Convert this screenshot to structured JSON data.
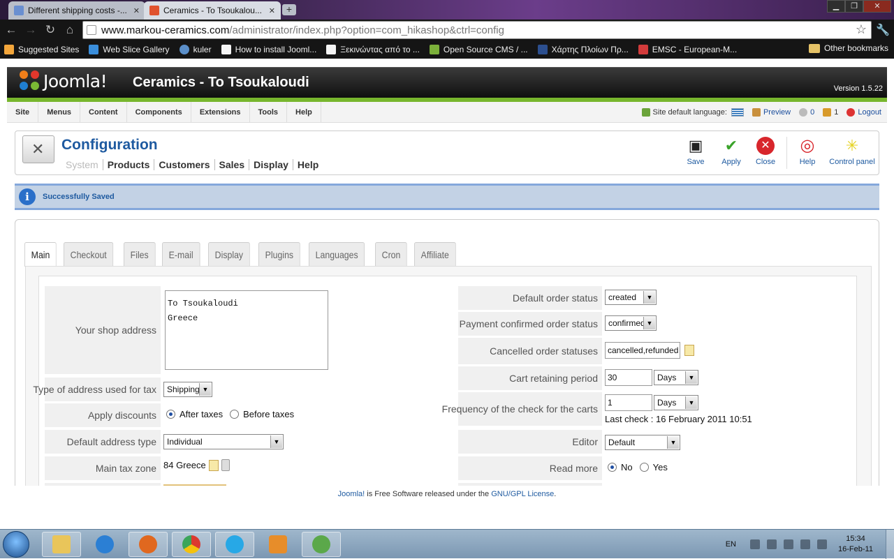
{
  "browser": {
    "tabs": [
      {
        "title": "Different shipping costs -...",
        "active": false
      },
      {
        "title": "Ceramics - To Tsoukalou...",
        "active": true
      }
    ],
    "url_domain": "www.markou-ceramics.com",
    "url_path": "/administrator/index.php?option=com_hikashop&ctrl=config",
    "bookmarks": [
      {
        "label": "Suggested Sites",
        "icon": "suggested-sites-icon"
      },
      {
        "label": "Web Slice Gallery",
        "icon": "web-slice-icon"
      },
      {
        "label": "kuler",
        "icon": "kuler-icon"
      },
      {
        "label": "How to install Jooml...",
        "icon": "page-icon"
      },
      {
        "label": "Ξεκινώντας από το ...",
        "icon": "page-icon"
      },
      {
        "label": "Open Source CMS / ...",
        "icon": "cube-icon"
      },
      {
        "label": "Χάρτης Πλοίων Πρ...",
        "icon": "ship-icon"
      },
      {
        "label": "EMSC - European-M...",
        "icon": "emsc-icon"
      }
    ],
    "other_bookmarks": "Other bookmarks"
  },
  "joomla": {
    "logo_text": "Joomla!",
    "site_title": "Ceramics - To Tsoukaloudi",
    "version": "Version 1.5.22",
    "menu": [
      "Site",
      "Menus",
      "Content",
      "Components",
      "Extensions",
      "Tools",
      "Help"
    ],
    "status": {
      "language_label": "Site default language:",
      "preview": "Preview",
      "messages_count": "0",
      "users_count": "1",
      "logout": "Logout"
    }
  },
  "config": {
    "title": "Configuration",
    "submenu": [
      "System",
      "Products",
      "Customers",
      "Sales",
      "Display",
      "Help"
    ],
    "toolbar": [
      "Save",
      "Apply",
      "Close",
      "Help",
      "Control panel"
    ],
    "message": "Successfully Saved",
    "tabs": [
      "Main",
      "Checkout",
      "Files",
      "E-mail",
      "Display",
      "Plugins",
      "Languages",
      "Cron",
      "Affiliate"
    ]
  },
  "form_left": {
    "shop_address_label": "Your shop address",
    "shop_address_line1": "To Tsoukaloudi",
    "shop_address_line2": "Greece",
    "tax_address_label": "Type of address used for tax",
    "tax_address_value": "Shipping",
    "apply_discounts_label": "Apply discounts",
    "apply_discounts_opt1": "After taxes",
    "apply_discounts_opt2": "Before taxes",
    "default_address_type_label": "Default address type",
    "default_address_type_value": "Individual",
    "main_tax_zone_label": "Main tax zone",
    "main_tax_zone_value": "84 Greece"
  },
  "form_right": {
    "default_order_status_label": "Default order status",
    "default_order_status_value": "created",
    "payment_confirmed_label": "Payment confirmed order status",
    "payment_confirmed_value": "confirmed",
    "cancelled_statuses_label": "Cancelled order statuses",
    "cancelled_statuses_value": "cancelled,refunded",
    "cart_retaining_label": "Cart retaining period",
    "cart_retaining_value": "30",
    "cart_retaining_unit": "Days",
    "frequency_label": "Frequency of the check for the carts",
    "frequency_value": "1",
    "frequency_unit": "Days",
    "last_check": "Last check : 16 February 2011 10:51",
    "editor_label": "Editor",
    "editor_value": "Default",
    "read_more_label": "Read more",
    "read_more_opt1": "No",
    "read_more_opt2": "Yes"
  },
  "footer": {
    "link1": "Joomla!",
    "text": " is Free Software released under the ",
    "link2": "GNU/GPL License",
    "end": "."
  },
  "taskbar": {
    "language": "EN",
    "time": "15:34",
    "date": "16-Feb-11"
  }
}
